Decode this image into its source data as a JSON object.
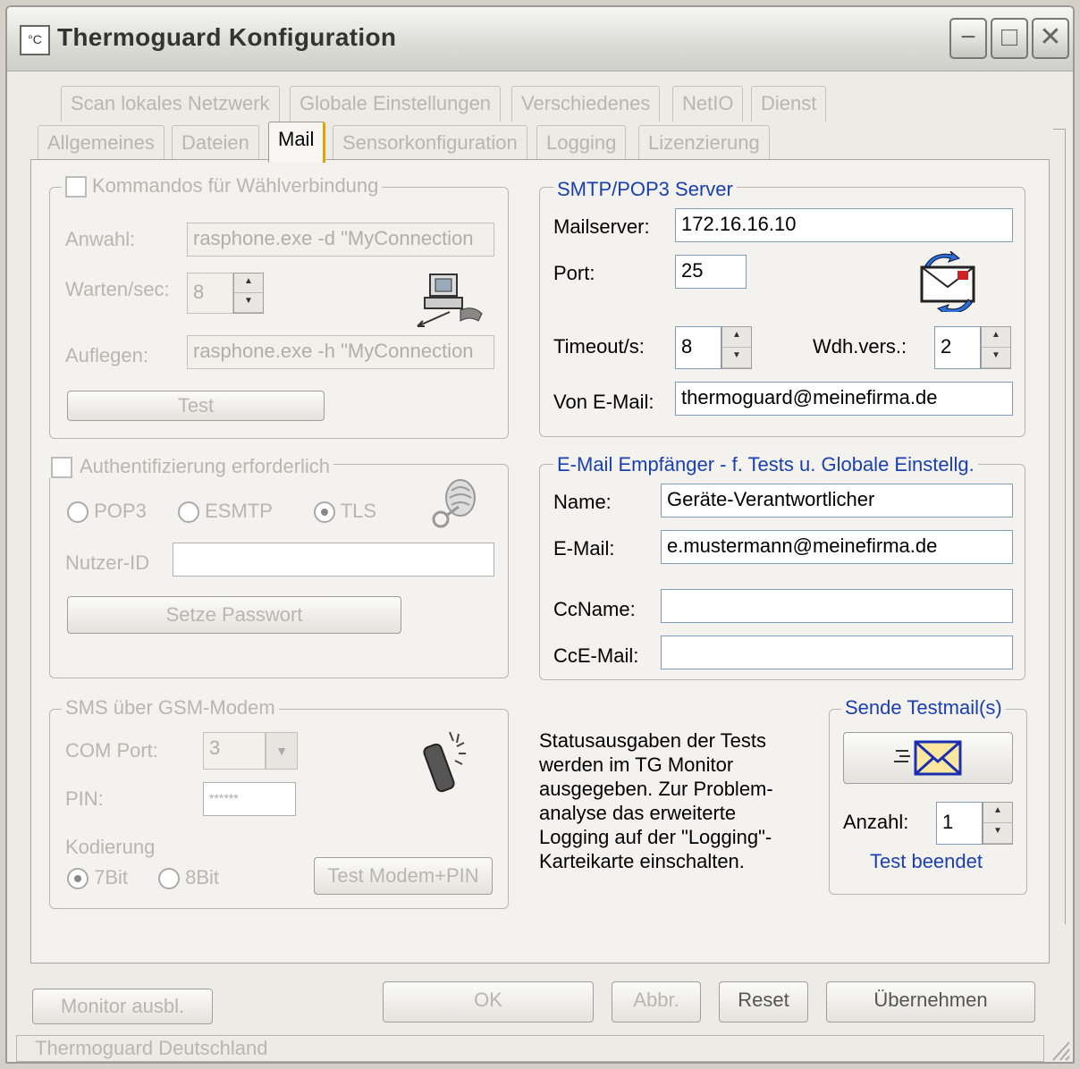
{
  "window": {
    "title": "Thermoguard Konfiguration",
    "icon_glyph": "°C"
  },
  "tabs_row1": [
    "Scan lokales Netzwerk",
    "Globale Einstellungen",
    "Verschiedenes",
    "NetIO",
    "Dienst"
  ],
  "tabs_row2": [
    "Allgemeines",
    "Dateien",
    "Mail",
    "Sensorkonfiguration",
    "Logging",
    "Lizenzierung"
  ],
  "dialup": {
    "legend": "Kommandos für Wählverbindung",
    "anwahl_label": "Anwahl:",
    "anwahl_value": "rasphone.exe -d \"MyConnection",
    "warten_label": "Warten/sec:",
    "warten_value": "8",
    "auflegen_label": "Auflegen:",
    "auflegen_value": "rasphone.exe -h \"MyConnection",
    "test_label": "Test"
  },
  "auth": {
    "legend": "Authentifizierung erforderlich",
    "pop3": "POP3",
    "esmtp": "ESMTP",
    "tls": "TLS",
    "nutzer_label": "Nutzer-ID",
    "nutzer_value": "",
    "passwort_button": "Setze Passwort"
  },
  "sms": {
    "legend": "SMS über GSM-Modem",
    "com_label": "COM Port:",
    "com_value": "3",
    "pin_label": "PIN:",
    "pin_value": "******",
    "kodierung_label": "Kodierung",
    "bit7": "7Bit",
    "bit8": "8Bit",
    "test_button": "Test Modem+PIN"
  },
  "smtp": {
    "legend": "SMTP/POP3 Server",
    "mailserver_label": "Mailserver:",
    "mailserver_value": "172.16.16.10",
    "port_label": "Port:",
    "port_value": "25",
    "timeout_label": "Timeout/s:",
    "timeout_value": "8",
    "wdh_label": "Wdh.vers.:",
    "wdh_value": "2",
    "von_label": "Von E-Mail:",
    "von_value": "thermoguard@meinefirma.de"
  },
  "recipient": {
    "legend": "E-Mail Empfänger - f. Tests u. Globale Einstellg.",
    "name_label": "Name:",
    "name_value": "Geräte-Verantwortlicher",
    "email_label": "E-Mail:",
    "email_value": "e.mustermann@meinefirma.de",
    "ccname_label": "CcName:",
    "ccname_value": "",
    "ccemail_label": "CcE-Mail:",
    "ccemail_value": ""
  },
  "status": {
    "lines": [
      "Statusausgaben der Tests",
      "werden im TG Monitor",
      "ausgegeben. Zur Problem-",
      "analyse das erweiterte",
      "Logging auf der \"Logging\"-",
      "Karteikarte einschalten."
    ]
  },
  "testmail": {
    "legend": "Sende Testmail(s)",
    "anzahl_label": "Anzahl:",
    "anzahl_value": "1",
    "result": "Test beendet"
  },
  "footer": {
    "monitor": "Monitor ausbl.",
    "ok": "OK",
    "abbr": "Abbr.",
    "reset": "Reset",
    "uebernehmen": "Übernehmen",
    "statusbar": "Thermoguard Deutschland"
  },
  "colors": {
    "legend_blue": "#1a3fb0",
    "tab_highlight": "#e8a000"
  }
}
